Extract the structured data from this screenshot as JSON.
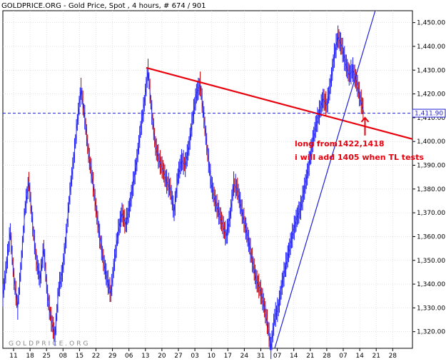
{
  "header": {
    "title": "GOLDPRICE.ORG - Gold Price, Spot , 4 hours, # 674 / 901"
  },
  "watermark": "GOLDPRICE.ORG",
  "colors": {
    "bars": "#1a1aff",
    "bars_down": "#cc0000",
    "trendlines_red": "#e8000d",
    "trendline_blue": "#1f1fd6",
    "price_line": "#3030e0",
    "grid": "#d0d0d0"
  },
  "chart_data": {
    "type": "line",
    "title": "GOLDPRICE.ORG - Gold Price, Spot , 4 hours, # 674 / 901",
    "y_ticks": [
      "1,450.00",
      "1,440.00",
      "1,430.00",
      "1,420.00",
      "1,410.00",
      "1,400.00",
      "1,390.00",
      "1,380.00",
      "1,370.00",
      "1,360.00",
      "1,350.00",
      "1,340.00",
      "1,330.00",
      "1,320.00"
    ],
    "y_tick_values": [
      1450,
      1440,
      1430,
      1420,
      1410,
      1400,
      1390,
      1380,
      1370,
      1360,
      1350,
      1340,
      1330,
      1320
    ],
    "ylim": [
      1313,
      1455
    ],
    "x_ticks": [
      "11",
      "18",
      "25",
      "08",
      "15",
      "22",
      "29",
      "06",
      "13",
      "20",
      "27",
      "03",
      "10",
      "17",
      "24",
      "31",
      "07",
      "14",
      "21",
      "28",
      "07",
      "14",
      "21",
      "28"
    ],
    "grid": true,
    "current_price": {
      "label": "1,411.90",
      "value": 1411.9
    },
    "price_path": [
      [
        0,
        1335
      ],
      [
        2,
        1348
      ],
      [
        4,
        1362
      ],
      [
        6,
        1342
      ],
      [
        8,
        1330
      ],
      [
        10,
        1350
      ],
      [
        12,
        1372
      ],
      [
        14,
        1383
      ],
      [
        16,
        1365
      ],
      [
        18,
        1350
      ],
      [
        20,
        1342
      ],
      [
        22,
        1355
      ],
      [
        24,
        1335
      ],
      [
        26,
        1325
      ],
      [
        28,
        1318
      ],
      [
        30,
        1338
      ],
      [
        32,
        1345
      ],
      [
        34,
        1360
      ],
      [
        36,
        1378
      ],
      [
        38,
        1392
      ],
      [
        40,
        1408
      ],
      [
        42,
        1422
      ],
      [
        44,
        1410
      ],
      [
        46,
        1395
      ],
      [
        48,
        1385
      ],
      [
        50,
        1372
      ],
      [
        52,
        1360
      ],
      [
        54,
        1350
      ],
      [
        56,
        1342
      ],
      [
        58,
        1336
      ],
      [
        60,
        1350
      ],
      [
        62,
        1362
      ],
      [
        64,
        1370
      ],
      [
        66,
        1365
      ],
      [
        68,
        1372
      ],
      [
        70,
        1382
      ],
      [
        72,
        1392
      ],
      [
        74,
        1405
      ],
      [
        76,
        1416
      ],
      [
        78,
        1430
      ],
      [
        80,
        1412
      ],
      [
        82,
        1398
      ],
      [
        84,
        1392
      ],
      [
        86,
        1388
      ],
      [
        88,
        1383
      ],
      [
        90,
        1380
      ],
      [
        92,
        1370
      ],
      [
        94,
        1385
      ],
      [
        96,
        1392
      ],
      [
        98,
        1390
      ],
      [
        100,
        1398
      ],
      [
        102,
        1410
      ],
      [
        104,
        1420
      ],
      [
        106,
        1424
      ],
      [
        108,
        1410
      ],
      [
        110,
        1395
      ],
      [
        112,
        1382
      ],
      [
        114,
        1375
      ],
      [
        116,
        1370
      ],
      [
        118,
        1365
      ],
      [
        120,
        1360
      ],
      [
        122,
        1368
      ],
      [
        124,
        1382
      ],
      [
        126,
        1380
      ],
      [
        128,
        1372
      ],
      [
        130,
        1365
      ],
      [
        132,
        1358
      ],
      [
        134,
        1350
      ],
      [
        136,
        1342
      ],
      [
        138,
        1338
      ],
      [
        140,
        1332
      ],
      [
        142,
        1324
      ],
      [
        144,
        1313
      ],
      [
        146,
        1326
      ],
      [
        148,
        1330
      ],
      [
        150,
        1340
      ],
      [
        152,
        1348
      ],
      [
        154,
        1355
      ],
      [
        156,
        1362
      ],
      [
        158,
        1368
      ],
      [
        160,
        1372
      ],
      [
        162,
        1380
      ],
      [
        164,
        1388
      ],
      [
        166,
        1398
      ],
      [
        168,
        1406
      ],
      [
        170,
        1412
      ],
      [
        172,
        1418
      ],
      [
        174,
        1415
      ],
      [
        176,
        1424
      ],
      [
        178,
        1436
      ],
      [
        180,
        1444
      ],
      [
        182,
        1440
      ],
      [
        184,
        1433
      ],
      [
        186,
        1428
      ],
      [
        188,
        1430
      ],
      [
        190,
        1425
      ],
      [
        192,
        1418
      ],
      [
        194,
        1412
      ]
    ],
    "x_range": [
      0,
      220
    ],
    "trendlines": [
      {
        "color": "red",
        "from": [
          77,
          1431
        ],
        "to": [
          220,
          1401
        ]
      },
      {
        "color": "blue",
        "from": [
          146,
          1313
        ],
        "to": [
          200,
          1455
        ]
      }
    ],
    "annotations": [
      "long from1422,1418",
      "i will add 1405 when TL tests"
    ]
  }
}
